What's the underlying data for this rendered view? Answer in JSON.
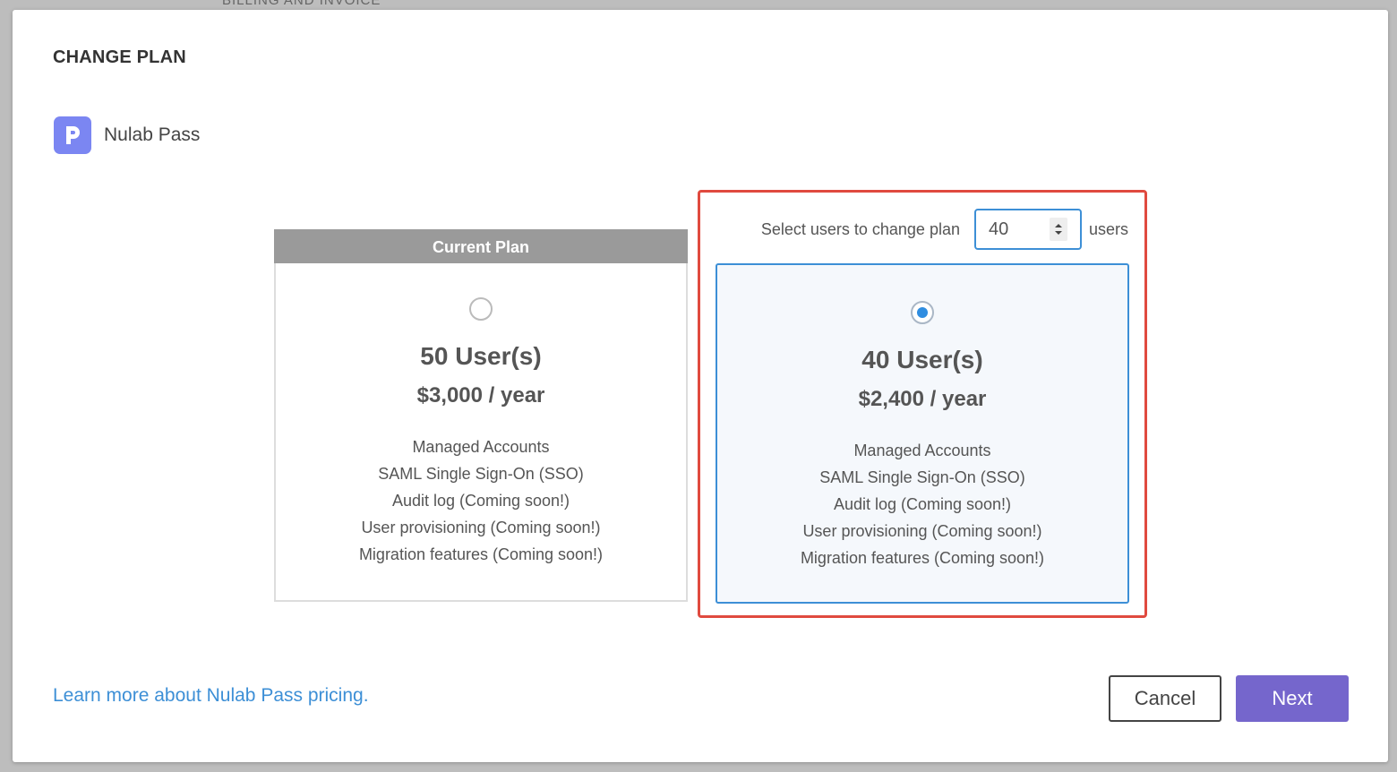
{
  "backdrop": {
    "text": "BILLING AND INVOICE"
  },
  "modal": {
    "title": "CHANGE PLAN",
    "product": {
      "name": "Nulab Pass",
      "logo_letter": "P",
      "logo_color": "#7b86f2"
    }
  },
  "current_plan": {
    "header": "Current Plan",
    "users": "50 User(s)",
    "price": "$3,000 / year",
    "selected": false,
    "features": [
      "Managed Accounts",
      "SAML Single Sign-On (SSO)",
      "Audit log (Coming soon!)",
      "User provisioning (Coming soon!)",
      "Migration features (Coming soon!)"
    ]
  },
  "new_plan": {
    "select_label": "Select users to change plan",
    "users_input_value": "40",
    "users_suffix": "users",
    "users": "40 User(s)",
    "price": "$2,400 / year",
    "selected": true,
    "features": [
      "Managed Accounts",
      "SAML Single Sign-On (SSO)",
      "Audit log (Coming soon!)",
      "User provisioning (Coming soon!)",
      "Migration features (Coming soon!)"
    ]
  },
  "footer": {
    "learn_link": "Learn more about Nulab Pass pricing.",
    "cancel_label": "Cancel",
    "next_label": "Next"
  },
  "colors": {
    "accent_blue": "#3d8fd6",
    "highlight_red": "#e04a3f",
    "next_purple": "#7566cc"
  }
}
